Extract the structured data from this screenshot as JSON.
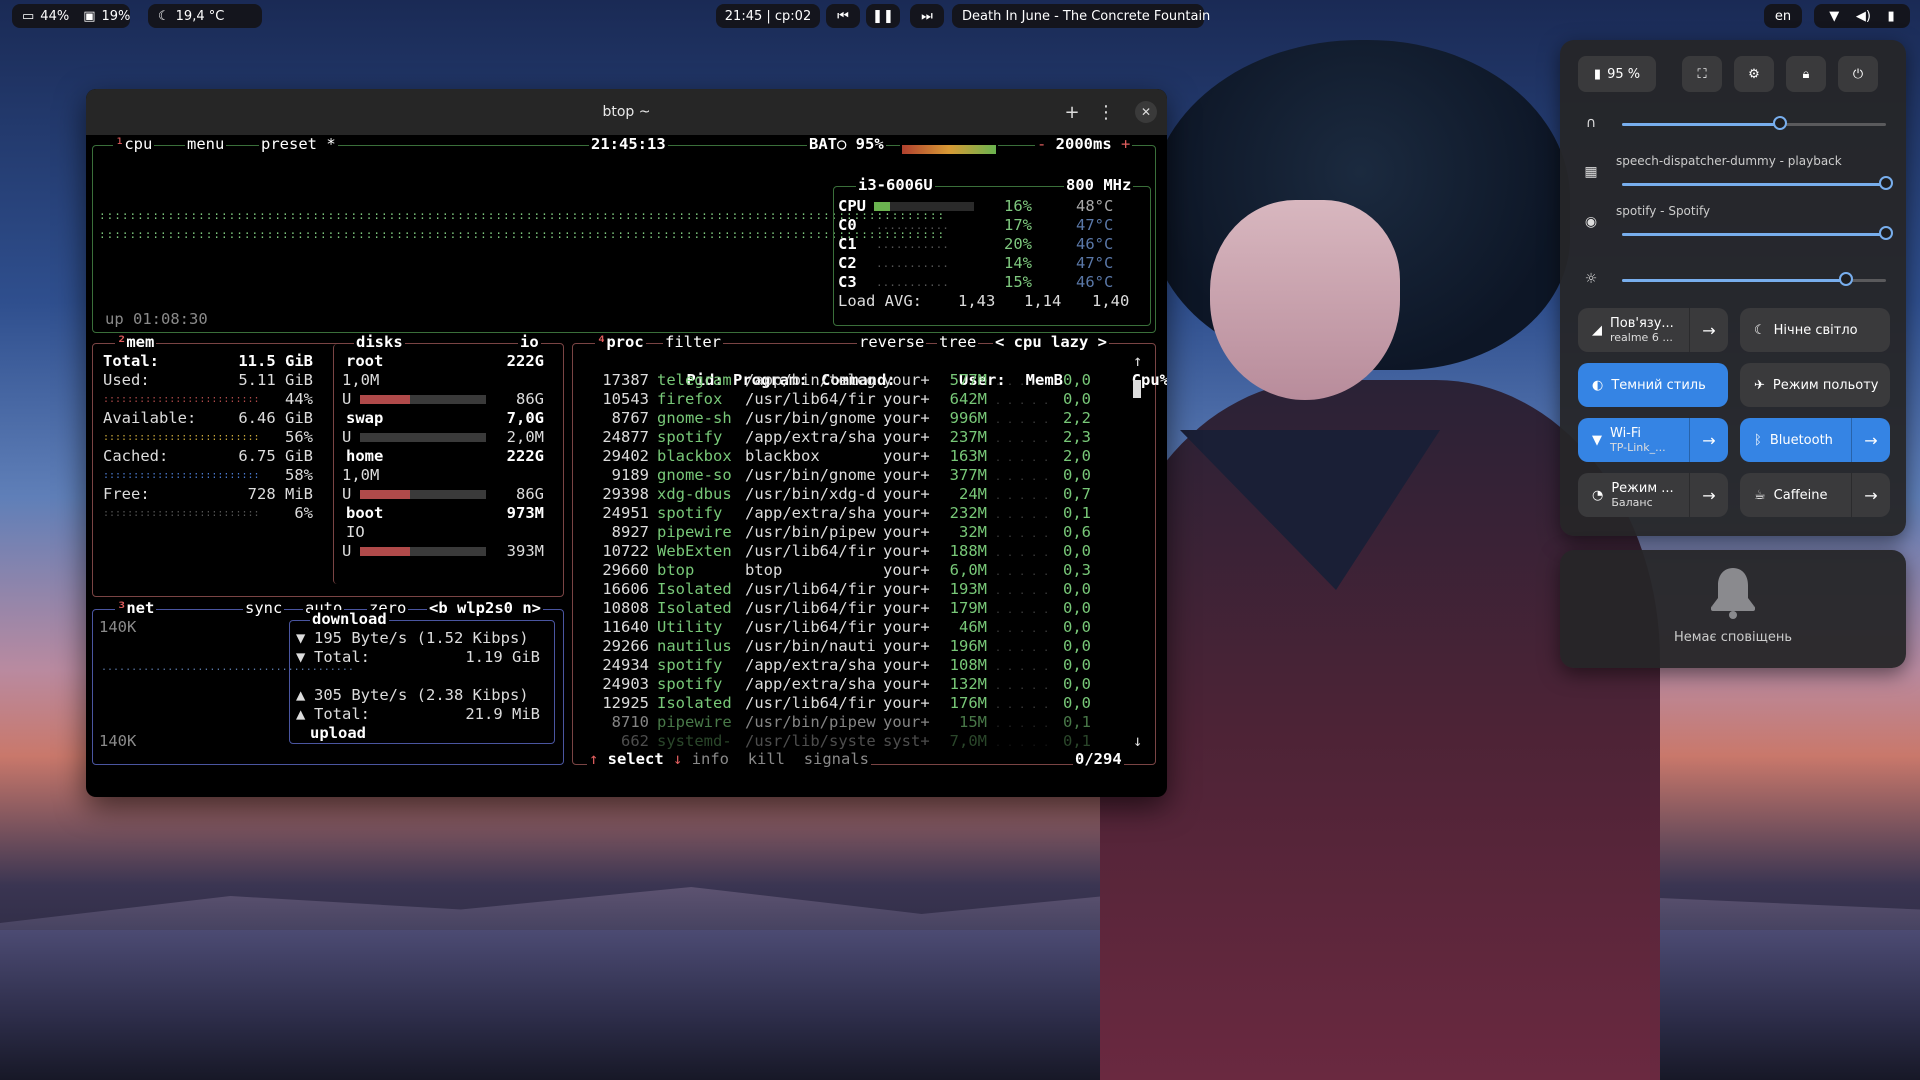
{
  "topbar": {
    "battery": "44%",
    "disk": "19%",
    "weather": "19,4 °C",
    "time_cpu": "21:45 | cp:02",
    "track": "Death In June - The Concrete Fountain",
    "lang": "en"
  },
  "window": {
    "title": "btop ~"
  },
  "btop": {
    "cpu_label": "cpu",
    "menu_label": "menu",
    "preset_label": "preset *",
    "clock": "21:45:13",
    "bat_label": "BAT○ 95%",
    "interval": "2000ms",
    "uptime": "up 01:08:30",
    "cpu_model": "i3-6006U",
    "cpu_freq": "800 MHz",
    "cores": [
      {
        "name": "CPU",
        "pct": "16%",
        "temp": "48°C"
      },
      {
        "name": "C0",
        "pct": "17%",
        "temp": "47°C"
      },
      {
        "name": "C1",
        "pct": "20%",
        "temp": "46°C"
      },
      {
        "name": "C2",
        "pct": "14%",
        "temp": "47°C"
      },
      {
        "name": "C3",
        "pct": "15%",
        "temp": "46°C"
      }
    ],
    "load_avg_label": "Load AVG:",
    "load_avg": [
      "1,43",
      "1,14",
      "1,40"
    ],
    "mem": {
      "title": "mem",
      "total_label": "Total:",
      "total": "11.5 GiB",
      "used_label": "Used:",
      "used": "5.11 GiB",
      "used_pct": "44%",
      "avail_label": "Available:",
      "avail": "6.46 GiB",
      "avail_pct": "56%",
      "cached_label": "Cached:",
      "cached": "6.75 GiB",
      "cached_pct": "58%",
      "free_label": "Free:",
      "free": "728 MiB",
      "free_pct": "6%"
    },
    "disks": {
      "title": "disks",
      "io_label": "io",
      "items": [
        {
          "name": "root",
          "size": "222G",
          "io": "1,0M",
          "u": "U",
          "free": "86G"
        },
        {
          "name": "swap",
          "size": "7,0G",
          "io": "",
          "u": "U",
          "free": "2,0M"
        },
        {
          "name": "home",
          "size": "222G",
          "io": "1,0M",
          "u": "U",
          "free": "86G"
        },
        {
          "name": "boot",
          "size": "973M",
          "io": "IO",
          "u": "U",
          "free": "393M"
        }
      ]
    },
    "net": {
      "title": "net",
      "sync": "sync",
      "auto": "auto",
      "zero": "zero",
      "iface": "<b wlp2s0 n>",
      "scale_top": "140K",
      "scale_bottom": "140K",
      "download_label": "download",
      "down_rate": "195 Byte/s (1.52 Kibps)",
      "down_total_label": "Total:",
      "down_total": "1.19 GiB",
      "up_rate": "305 Byte/s (2.38 Kibps)",
      "up_total_label": "Total:",
      "up_total": "21.9 MiB",
      "upload_label": "upload"
    },
    "proc": {
      "title": "proc",
      "filter": "filter",
      "reverse": "reverse",
      "tree": "tree",
      "sort": "< cpu lazy >",
      "header": {
        "pid": "Pid:",
        "program": "Program:",
        "command": "Command:",
        "user": "User:",
        "memb": "MemB",
        "cpu": "Cpu%"
      },
      "rows": [
        {
          "pid": "17387",
          "program": "telegram",
          "command": "/app/bin/teleg",
          "user": "your+",
          "memb": "577M",
          "cpu": "0,0"
        },
        {
          "pid": "10543",
          "program": "firefox",
          "command": "/usr/lib64/fir",
          "user": "your+",
          "memb": "642M",
          "cpu": "0,0"
        },
        {
          "pid": "8767",
          "program": "gnome-sh",
          "command": "/usr/bin/gnome",
          "user": "your+",
          "memb": "996M",
          "cpu": "2,2"
        },
        {
          "pid": "24877",
          "program": "spotify",
          "command": "/app/extra/sha",
          "user": "your+",
          "memb": "237M",
          "cpu": "2,3"
        },
        {
          "pid": "29402",
          "program": "blackbox",
          "command": "blackbox",
          "user": "your+",
          "memb": "163M",
          "cpu": "2,0"
        },
        {
          "pid": "9189",
          "program": "gnome-so",
          "command": "/usr/bin/gnome",
          "user": "your+",
          "memb": "377M",
          "cpu": "0,0"
        },
        {
          "pid": "29398",
          "program": "xdg-dbus",
          "command": "/usr/bin/xdg-d",
          "user": "your+",
          "memb": "24M",
          "cpu": "0,7"
        },
        {
          "pid": "24951",
          "program": "spotify",
          "command": "/app/extra/sha",
          "user": "your+",
          "memb": "232M",
          "cpu": "0,1"
        },
        {
          "pid": "8927",
          "program": "pipewire",
          "command": "/usr/bin/pipew",
          "user": "your+",
          "memb": "32M",
          "cpu": "0,6"
        },
        {
          "pid": "10722",
          "program": "WebExten",
          "command": "/usr/lib64/fir",
          "user": "your+",
          "memb": "188M",
          "cpu": "0,0"
        },
        {
          "pid": "29660",
          "program": "btop",
          "command": "btop",
          "user": "your+",
          "memb": "6,0M",
          "cpu": "0,3"
        },
        {
          "pid": "16606",
          "program": "Isolated",
          "command": "/usr/lib64/fir",
          "user": "your+",
          "memb": "193M",
          "cpu": "0,0"
        },
        {
          "pid": "10808",
          "program": "Isolated",
          "command": "/usr/lib64/fir",
          "user": "your+",
          "memb": "179M",
          "cpu": "0,0"
        },
        {
          "pid": "11640",
          "program": "Utility",
          "command": "/usr/lib64/fir",
          "user": "your+",
          "memb": "46M",
          "cpu": "0,0"
        },
        {
          "pid": "29266",
          "program": "nautilus",
          "command": "/usr/bin/nauti",
          "user": "your+",
          "memb": "196M",
          "cpu": "0,0"
        },
        {
          "pid": "24934",
          "program": "spotify",
          "command": "/app/extra/sha",
          "user": "your+",
          "memb": "108M",
          "cpu": "0,0"
        },
        {
          "pid": "24903",
          "program": "spotify",
          "command": "/app/extra/sha",
          "user": "your+",
          "memb": "132M",
          "cpu": "0,0"
        },
        {
          "pid": "12925",
          "program": "Isolated",
          "command": "/usr/lib64/fir",
          "user": "your+",
          "memb": "176M",
          "cpu": "0,0"
        },
        {
          "pid": "8710",
          "program": "pipewire",
          "command": "/usr/bin/pipew",
          "user": "your+",
          "memb": "15M",
          "cpu": "0,1"
        },
        {
          "pid": "662",
          "program": "systemd-",
          "command": "/usr/lib/syste",
          "user": "syst+",
          "memb": "7,0M",
          "cpu": "0,1"
        }
      ],
      "footer_select": "select",
      "footer_info": "info",
      "footer_kill": "kill",
      "footer_signals": "signals",
      "count": "0/294"
    }
  },
  "quick_settings": {
    "battery": "95 %",
    "slider_labels": {
      "speech": "speech-dispatcher-dummy - playback",
      "spotify": "spotify - Spotify"
    },
    "levels": {
      "output": 0.6,
      "speech": 1.0,
      "spotify": 1.0,
      "brightness": 0.85
    },
    "tiles": {
      "connect_title": "Пов'язу...",
      "connect_sub": "realme 6 ...",
      "night_light": "Нічне світло",
      "dark_style": "Темний стиль",
      "airplane": "Режим польоту",
      "wifi_title": "Wi-Fi",
      "wifi_sub": "TP-Link_...",
      "bluetooth": "Bluetooth",
      "power_title": "Режим ...",
      "power_sub": "Баланс",
      "caffeine": "Caffeine"
    },
    "accent": "#3584e4"
  },
  "notifications": {
    "empty": "Немає сповіщень"
  }
}
